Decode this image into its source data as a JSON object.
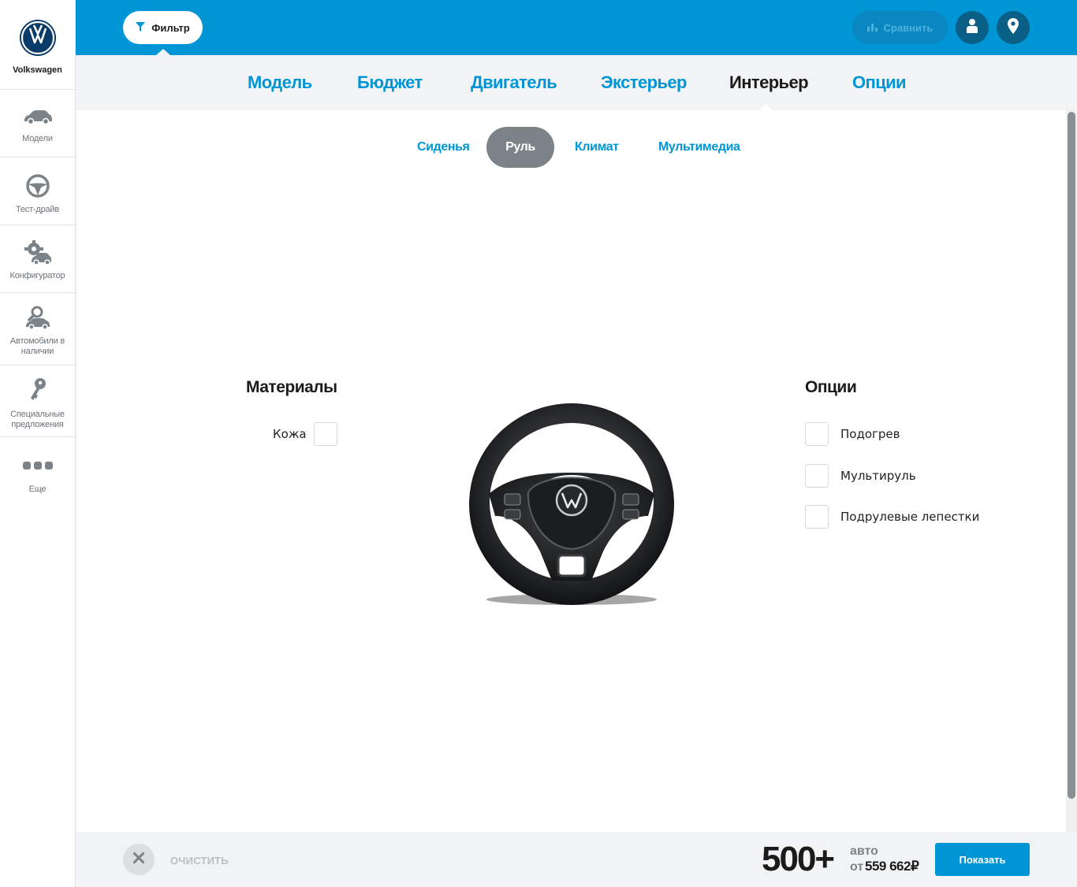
{
  "brand": {
    "name": "Volkswagen",
    "logo_icon": "vw-logo-icon"
  },
  "sidebar": {
    "items": [
      {
        "label": "Модели",
        "icon": "car-icon"
      },
      {
        "label": "Тест-драйв",
        "icon": "steering-wheel-icon"
      },
      {
        "label": "Конфигуратор",
        "icon": "configurator-icon"
      },
      {
        "label": "Автомобили в наличии",
        "icon": "car-search-icon"
      },
      {
        "label": "Специальные предложения",
        "icon": "key-icon"
      },
      {
        "label": "Еще",
        "icon": "more-dots-icon"
      }
    ]
  },
  "topbar": {
    "filter_label": "Фильтр",
    "compare_label": "Сравнить",
    "user_icon": "user-icon",
    "location_icon": "location-pin-icon"
  },
  "tabs": [
    {
      "label": "Модель"
    },
    {
      "label": "Бюджет"
    },
    {
      "label": "Двигатель"
    },
    {
      "label": "Экстерьер"
    },
    {
      "label": "Интерьер",
      "active": true
    },
    {
      "label": "Опции"
    }
  ],
  "subtabs": [
    {
      "label": "Сиденья"
    },
    {
      "label": "Руль",
      "active": true
    },
    {
      "label": "Климат"
    },
    {
      "label": "Мультимедиа"
    }
  ],
  "materials": {
    "title": "Материалы",
    "items": [
      {
        "label": "Кожа",
        "checked": false
      }
    ]
  },
  "options": {
    "title": "Опции",
    "items": [
      {
        "label": "Подогрев",
        "checked": false
      },
      {
        "label": "Мультируль",
        "checked": false
      },
      {
        "label": "Подрулевые лепестки",
        "checked": false
      }
    ]
  },
  "footer": {
    "clear_label": "ОЧИСТИТЬ",
    "count": "500+",
    "count_unit": "авто",
    "price_prefix": "от",
    "price_value": "559 662₽",
    "show_label": "Показать"
  },
  "colors": {
    "accent": "#0096d6",
    "active_subtab": "#7c8388",
    "tabs_bg": "#f2f3f5"
  }
}
